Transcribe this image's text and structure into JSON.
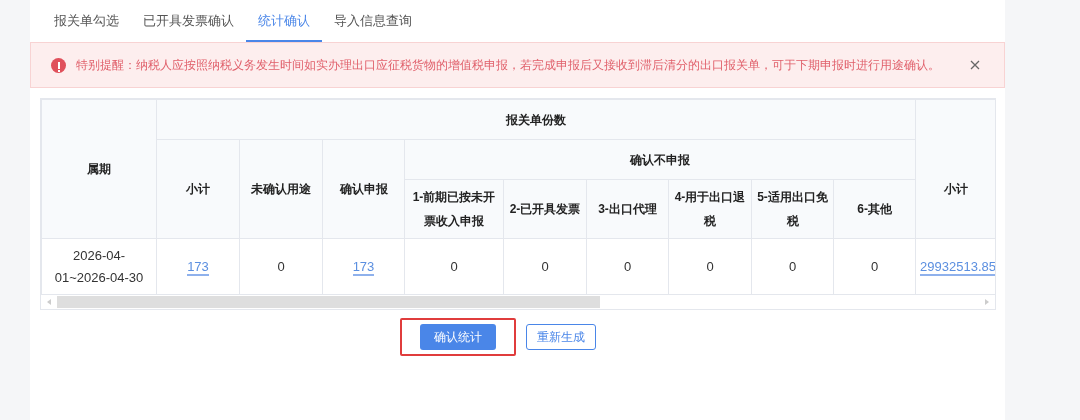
{
  "tabs": [
    {
      "label": "报关单勾选",
      "selected": false
    },
    {
      "label": "已开具发票确认",
      "selected": false
    },
    {
      "label": "统计确认",
      "selected": true
    },
    {
      "label": "导入信息查询",
      "selected": false
    }
  ],
  "alert": {
    "text": "特别提醒：纳税人应按照纳税义务发生时间如实办理出口应征税货物的增值税申报，若完成申报后又接收到滞后清分的出口报关单，可于下期申报时进行用途确认。"
  },
  "table": {
    "period_header": "属期",
    "group_header": "报关单份数",
    "columns": [
      "小计",
      "未确认用途",
      "确认申报"
    ],
    "subgroup": {
      "title": "确认不申报",
      "columns": [
        "1-前期已按未开票收入申报",
        "2-已开具发票",
        "3-出口代理",
        "4-用于出口退税",
        "5-适用出口免税",
        "6-其他"
      ]
    },
    "trailing_column": "小计",
    "rows": [
      {
        "period": "2026-04-01~2026-04-30",
        "cells": [
          {
            "text": "173",
            "link": true
          },
          {
            "text": "0",
            "link": false
          },
          {
            "text": "173",
            "link": true
          },
          {
            "text": "0",
            "link": false
          },
          {
            "text": "0",
            "link": false
          },
          {
            "text": "0",
            "link": false
          },
          {
            "text": "0",
            "link": false
          },
          {
            "text": "0",
            "link": false
          },
          {
            "text": "0",
            "link": false
          },
          {
            "text": "29932513.85",
            "link": true
          }
        ]
      }
    ]
  },
  "buttons": [
    {
      "label": "确认统计",
      "kind": "primary",
      "highlighted": true
    },
    {
      "label": "重新生成",
      "kind": "outline",
      "highlighted": false
    }
  ]
}
